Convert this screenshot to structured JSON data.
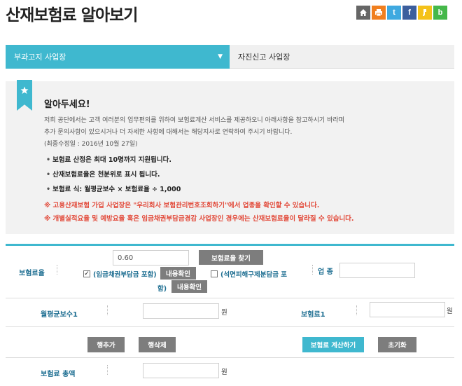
{
  "header": {
    "title": "산재보험료 알아보기",
    "share": [
      {
        "name": "home-icon",
        "label": "",
        "color": "#666666"
      },
      {
        "name": "print-icon",
        "label": "",
        "color": "#f07f1f"
      },
      {
        "name": "twitter-icon",
        "label": "t",
        "color": "#3fa9e0"
      },
      {
        "name": "facebook-icon",
        "label": "f",
        "color": "#3b5e9d"
      },
      {
        "name": "kakaostory-icon",
        "label": "",
        "color": "#f4c21a"
      },
      {
        "name": "band-icon",
        "label": "b",
        "color": "#45b84a"
      }
    ]
  },
  "tabs": {
    "active": "부과고지 사업장",
    "inactive": "자진신고 사업장"
  },
  "notice": {
    "title": "알아두세요!",
    "desc1": "저희 공단에서는 고객 여러분의 업무편의를 위하여 보험료계산 서비스를 제공하오니 아래사항을 참고하시기 바라며",
    "desc2": "추가 문의사항이 있으시거나 더 자세한 사항에 대해서는 해당지사로 연락하여 주시기 바랍니다.",
    "updated": "(최종수정일 : 2016년 10월 27일)",
    "items": [
      "보험료 산정은 최대 10명까지 지원됩니다.",
      "산재보험료율은 천분위로 표시 됩니다.",
      "보험료 식: 월평균보수 × 보험료율 ÷ 1,000"
    ],
    "warn1": "※ 고용산재보험 가입 사업장은 \"우리회사 보험관리번호조회하기\"에서 업종을 확인할 수 있습니다.",
    "warn2": "※ 개별실적요율 및 예방요율 혹은 임금채권부담금경감 사업장인 경우에는 산재보험료율이 달라질 수 있습니다."
  },
  "form": {
    "rate_label": "보험료율",
    "rate_value": "0.60",
    "find_rate_btn": "보험료율 찾기",
    "wage_claim_label": "(임금채권부담금 포함)",
    "wage_claim_checked": true,
    "detail_btn": "내용확인",
    "asbestos_label_1": "(석면피해구제분담금 포",
    "asbestos_label_2": "함)",
    "asbestos_checked": false,
    "industry_label": "업 종",
    "industry_value": "",
    "monthly_wage_label": "월평균보수1",
    "monthly_wage_value": "",
    "won": "원",
    "premium_label": "보험료1",
    "premium_value": "",
    "add_row_btn": "행추가",
    "delete_row_btn": "행삭제",
    "calc_btn": "보험료 계산하기",
    "reset_btn": "초기화",
    "total_label": "보험료 총액",
    "total_value": ""
  }
}
